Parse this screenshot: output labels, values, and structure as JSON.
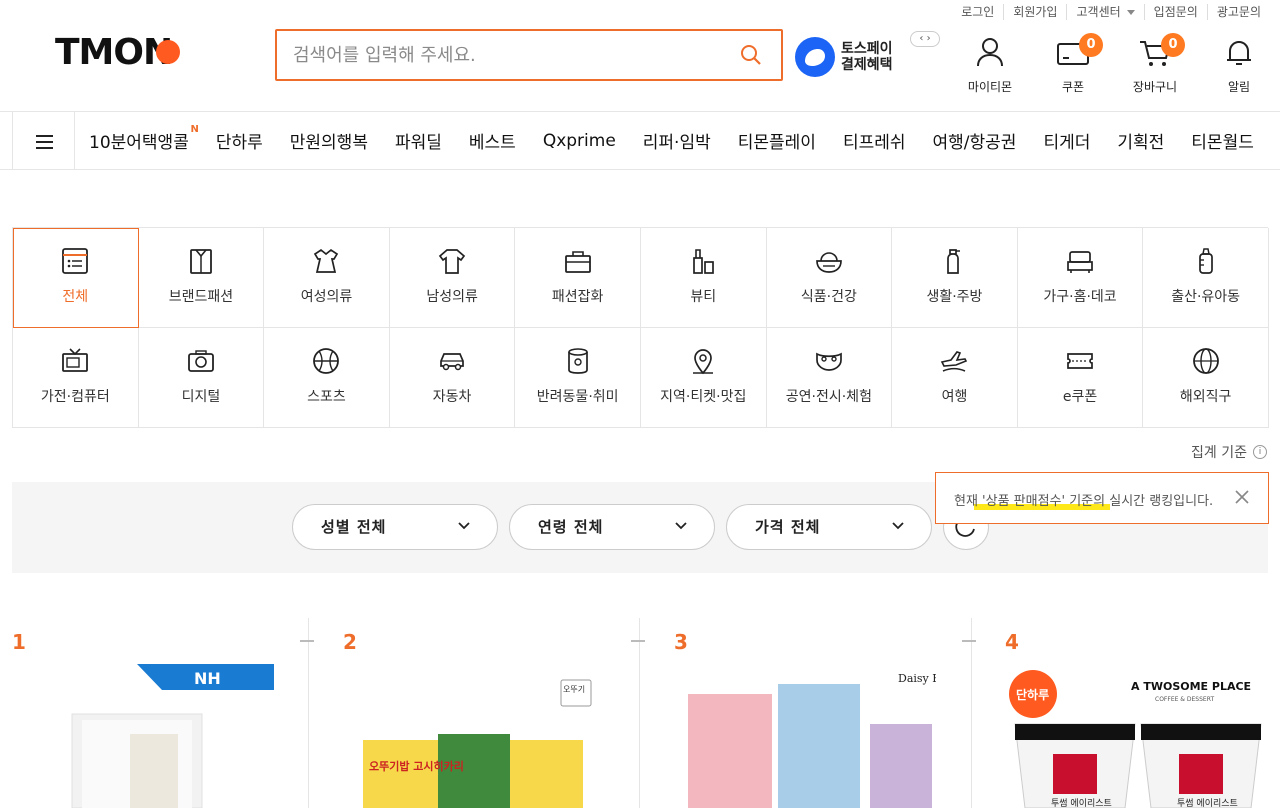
{
  "util_links": [
    "로그인",
    "회원가입",
    "고객센터",
    "입점문의",
    "광고문의"
  ],
  "logo": "TMON",
  "search": {
    "placeholder": "검색어를 입력해 주세요."
  },
  "toss": {
    "line1": "토스페이",
    "line2": "결제혜택"
  },
  "header_icons": {
    "mytmon": "마이티몬",
    "coupon": "쿠폰",
    "coupon_count": "0",
    "cart": "장바구니",
    "cart_count": "0",
    "alarm": "알림"
  },
  "nav": {
    "items": [
      "10분어택앵콜",
      "단하루",
      "만원의행복",
      "파워딜",
      "베스트",
      "Qxprime",
      "리퍼·임박",
      "티몬플레이",
      "티프레쉬",
      "여행/항공권",
      "티게더",
      "기획전",
      "티몬월드"
    ],
    "new_badge": "N"
  },
  "categories": [
    "전체",
    "브랜드패션",
    "여성의류",
    "남성의류",
    "패션잡화",
    "뷰티",
    "식품·건강",
    "생활·주방",
    "가구·홈·데코",
    "출산·유아동",
    "가전·컴퓨터",
    "디지털",
    "스포츠",
    "자동차",
    "반려동물·취미",
    "지역·티켓·맛집",
    "공연·전시·체험",
    "여행",
    "e쿠폰",
    "해외직구"
  ],
  "criteria_label": "집계 기준",
  "filters": {
    "gender": "성별 전체",
    "age": "연령 전체",
    "price": "가격 전체"
  },
  "tooltip": "현재 '상품 판매점수' 기준의 실시간 랭킹입니다.",
  "products": [
    {
      "rank": "1",
      "brand": "NH"
    },
    {
      "rank": "2",
      "brand": "오뚜기",
      "title": "오뚜기밥 고시히카리"
    },
    {
      "rank": "3",
      "brand": "Daisy Rose"
    },
    {
      "rank": "4",
      "badge": "단하루",
      "brand": "A TWOSOME PLACE",
      "sub": "COFFEE & DESSERT",
      "cup_label": "투썸 에이리스트"
    }
  ],
  "colors": {
    "accent": "#ef6d2a",
    "toss_blue": "#1b64f5",
    "badge_orange": "#ff7a21"
  }
}
